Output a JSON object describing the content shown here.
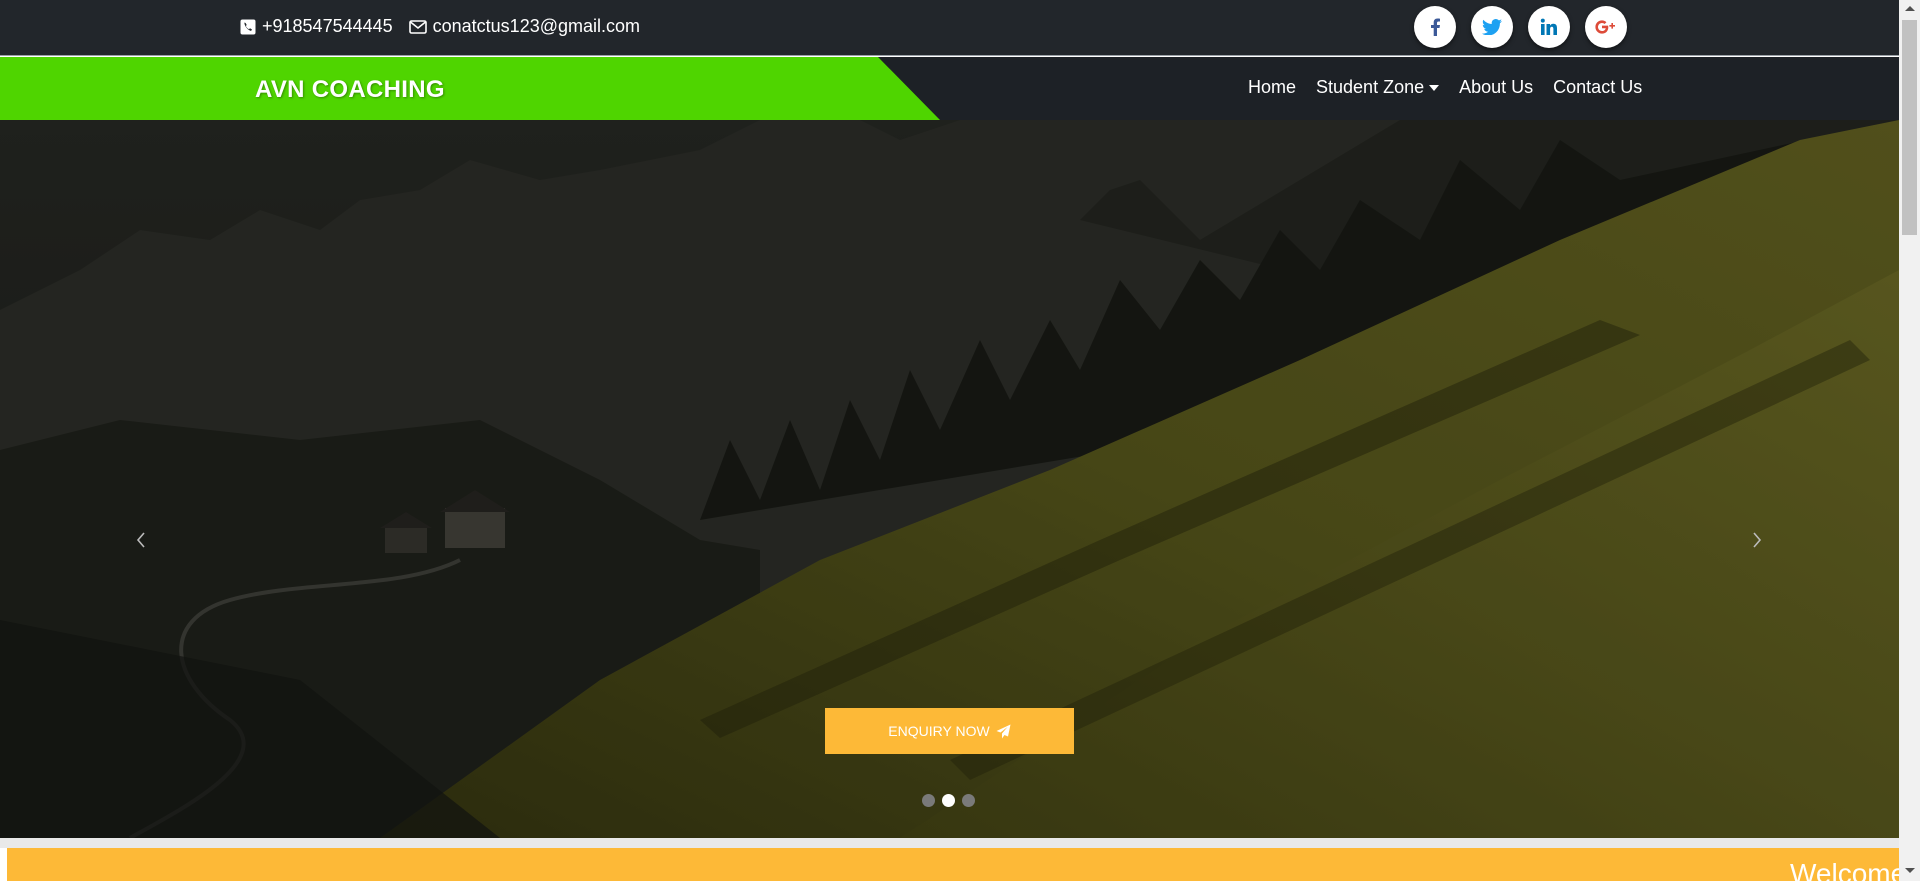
{
  "topbar": {
    "phone": "+918547544445",
    "email": "conatctus123@gmail.com",
    "social": [
      {
        "icon": "facebook-icon",
        "glyph": "f",
        "color": "#3b5998"
      },
      {
        "icon": "twitter-icon",
        "glyph": "t",
        "color": "#1da1f2"
      },
      {
        "icon": "linkedin-icon",
        "glyph": "in",
        "color": "#0077b5"
      },
      {
        "icon": "google-plus-icon",
        "glyph": "G+",
        "color": "#dd4b39"
      }
    ]
  },
  "navbar": {
    "brand": "AVN COACHING",
    "brand_color": "#4fd500",
    "links": {
      "home": "Home",
      "student_zone": "Student Zone",
      "about": "About Us",
      "contact": "Contact Us"
    }
  },
  "hero": {
    "cta_label": "ENQUIRY NOW",
    "cta_color": "#fdb937",
    "slides": 3,
    "active_slide": 2
  },
  "welcome": {
    "text": "Welcome"
  }
}
